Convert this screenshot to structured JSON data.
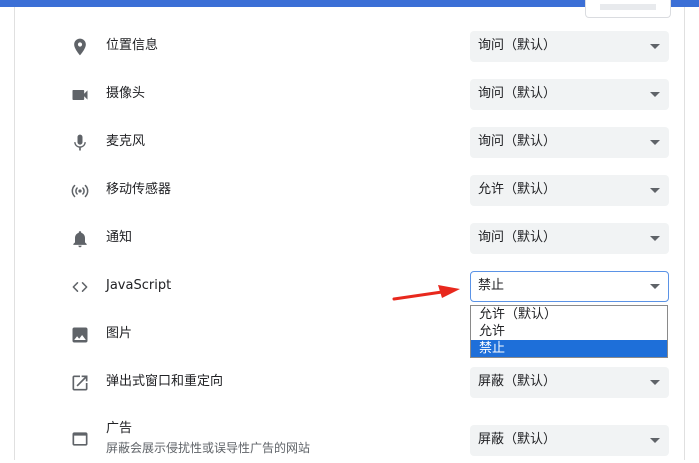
{
  "rows": [
    {
      "icon": "location-pin-icon",
      "label": "位置信息",
      "value": "询问（默认）"
    },
    {
      "icon": "video-camera-icon",
      "label": "摄像头",
      "value": "询问（默认）"
    },
    {
      "icon": "microphone-icon",
      "label": "麦克风",
      "value": "询问（默认）"
    },
    {
      "icon": "motion-sensor-icon",
      "label": "移动传感器",
      "value": "允许（默认）"
    },
    {
      "icon": "bell-icon",
      "label": "通知",
      "value": "询问（默认）"
    },
    {
      "icon": "code-brackets-icon",
      "label": "JavaScript",
      "value": "禁止"
    },
    {
      "icon": "image-icon",
      "label": "图片",
      "value": ""
    },
    {
      "icon": "open-in-new-icon",
      "label": "弹出式窗口和重定向",
      "value": "屏蔽（默认）"
    },
    {
      "icon": "ad-window-icon",
      "label": "广告",
      "sublabel": "屏蔽会展示侵扰性或误导性广告的网站",
      "value": "屏蔽（默认）"
    }
  ],
  "dropdown": {
    "options": [
      "允许（默认）",
      "允许",
      "禁止"
    ],
    "selected": "禁止"
  },
  "colors": {
    "accent": "#3b6fd6",
    "selected_option": "#1e6fd9",
    "annotation_arrow": "#e8281d"
  }
}
